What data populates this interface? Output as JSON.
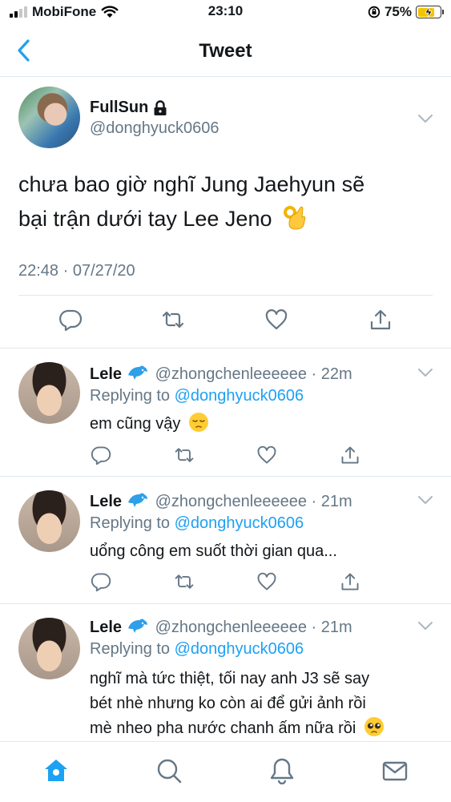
{
  "status_bar": {
    "carrier": "MobiFone",
    "time": "23:10",
    "battery_percent": "75%",
    "battery_level": 0.75,
    "icons": [
      "signal-icon",
      "wifi-icon",
      "orientation-lock-icon",
      "battery-icon"
    ]
  },
  "nav": {
    "title": "Tweet",
    "back_icon": "chevron-left-icon"
  },
  "main_tweet": {
    "display_name": "FullSun",
    "handle": "@donghyuck0606",
    "locked": true,
    "text_line1": "chưa bao giờ nghĩ Jung Jaehyun sẽ",
    "text_line2": "bại trận dưới tay Lee Jeno",
    "emoji": "ok-hand",
    "timestamp": "22:48 · 07/27/20",
    "actions": [
      "reply-icon",
      "retweet-icon",
      "like-icon",
      "share-icon"
    ]
  },
  "replies": [
    {
      "name": "Lele",
      "handle": "@zhongchenleeeeee",
      "time": "· 22m",
      "replying_label": "Replying to",
      "replying_to": "@donghyuck0606",
      "text": "em cũng vậy",
      "emoji": "pensive"
    },
    {
      "name": "Lele",
      "handle": "@zhongchenleeeeee",
      "time": "· 21m",
      "replying_label": "Replying to",
      "replying_to": "@donghyuck0606",
      "text": "uổng công em suốt thời gian qua..."
    },
    {
      "name": "Lele",
      "handle": "@zhongchenleeeeee",
      "time": "· 21m",
      "replying_label": "Replying to",
      "replying_to": "@donghyuck0606",
      "text_line1": "nghĩ mà tức thiệt, tối nay anh J3 sẽ say",
      "text_line2": "bét nhè nhưng ko còn ai để gửi ảnh rồi",
      "text_line3": "mè nheo pha nước chanh ấm nữa rồi",
      "emoji": "pleading"
    }
  ],
  "tab_bar": {
    "tabs": [
      "home-icon",
      "search-icon",
      "notifications-icon",
      "messages-icon"
    ],
    "active": "home-icon"
  },
  "colors": {
    "accent": "#1da1f2",
    "secondary_text": "#657786",
    "divider": "#e1e8ed",
    "text": "#14171a"
  }
}
